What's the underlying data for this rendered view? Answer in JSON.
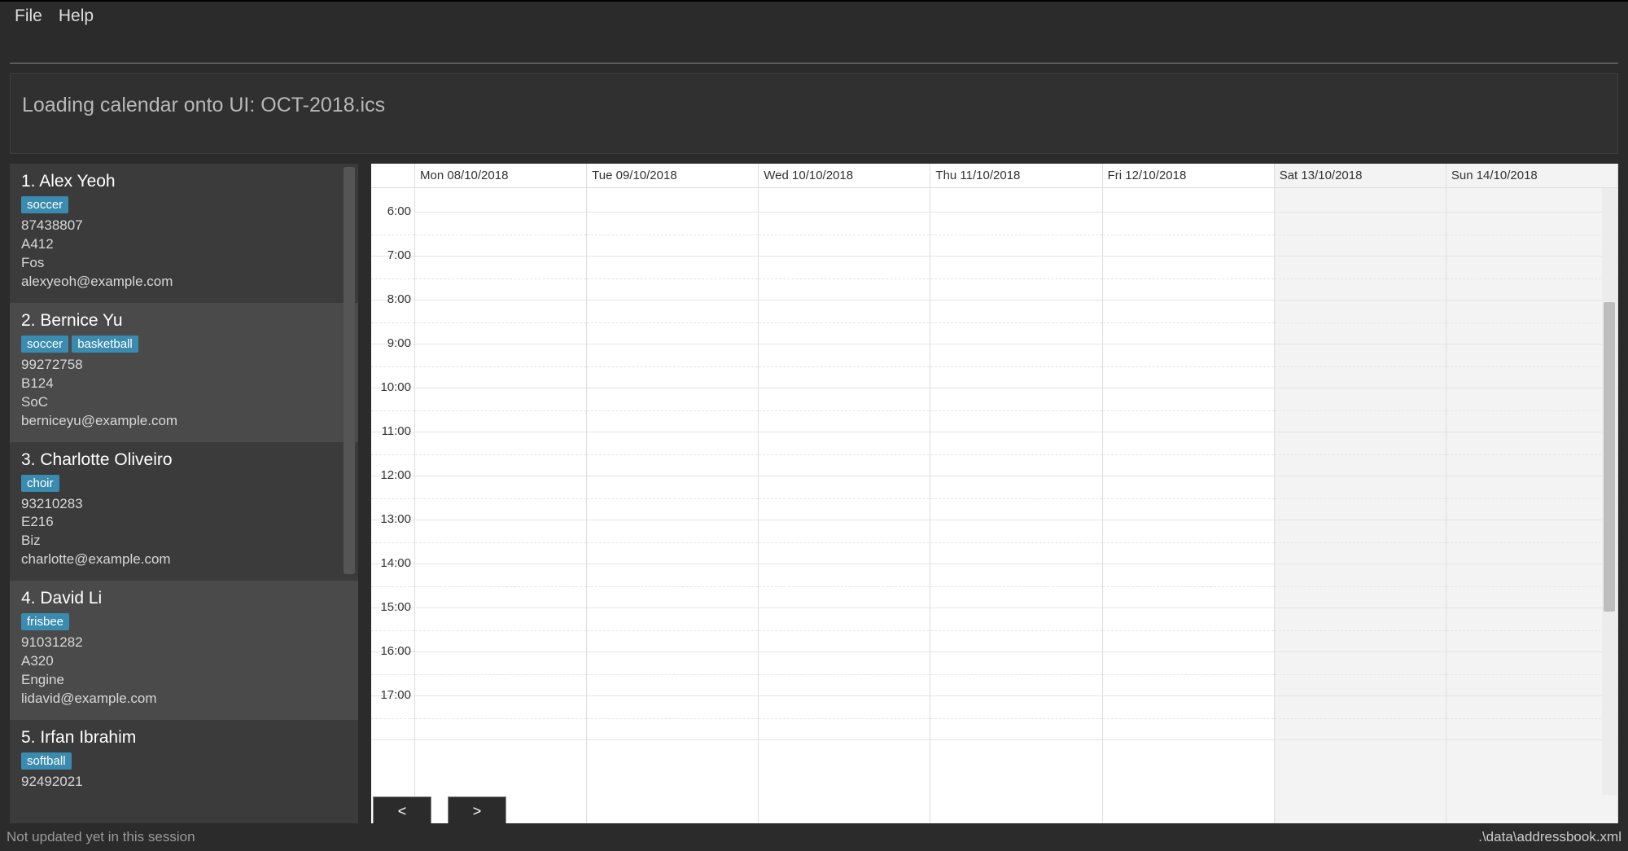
{
  "menu": {
    "file": "File",
    "help": "Help"
  },
  "status_message": "Loading calendar onto UI: OCT-2018.ics",
  "contacts": [
    {
      "index": "1.",
      "name": "Alex Yeoh",
      "tags": [
        "soccer"
      ],
      "phone": "87438807",
      "room": "A412",
      "faculty": "Fos",
      "email": "alexyeoh@example.com"
    },
    {
      "index": "2.",
      "name": "Bernice Yu",
      "tags": [
        "soccer",
        "basketball"
      ],
      "phone": "99272758",
      "room": "B124",
      "faculty": "SoC",
      "email": "berniceyu@example.com"
    },
    {
      "index": "3.",
      "name": "Charlotte Oliveiro",
      "tags": [
        "choir"
      ],
      "phone": "93210283",
      "room": "E216",
      "faculty": "Biz",
      "email": "charlotte@example.com"
    },
    {
      "index": "4.",
      "name": "David Li",
      "tags": [
        "frisbee"
      ],
      "phone": "91031282",
      "room": "A320",
      "faculty": "Engine",
      "email": "lidavid@example.com"
    },
    {
      "index": "5.",
      "name": "Irfan Ibrahim",
      "tags": [
        "softball"
      ],
      "phone": "92492021",
      "room": "",
      "faculty": "",
      "email": ""
    }
  ],
  "calendar": {
    "days": [
      {
        "label": "Mon 08/10/2018",
        "weekend": false
      },
      {
        "label": "Tue 09/10/2018",
        "weekend": false
      },
      {
        "label": "Wed 10/10/2018",
        "weekend": false
      },
      {
        "label": "Thu 11/10/2018",
        "weekend": false
      },
      {
        "label": "Fri 12/10/2018",
        "weekend": false
      },
      {
        "label": "Sat 13/10/2018",
        "weekend": true
      },
      {
        "label": "Sun 14/10/2018",
        "weekend": true
      }
    ],
    "time_slots": [
      "6:00",
      "7:00",
      "8:00",
      "9:00",
      "10:00",
      "11:00",
      "12:00",
      "13:00",
      "14:00",
      "15:00",
      "16:00",
      "17:00"
    ],
    "nav": {
      "prev": "<",
      "next": ">"
    }
  },
  "footer": {
    "left": "Not updated yet in this session",
    "right": ".\\data\\addressbook.xml"
  }
}
